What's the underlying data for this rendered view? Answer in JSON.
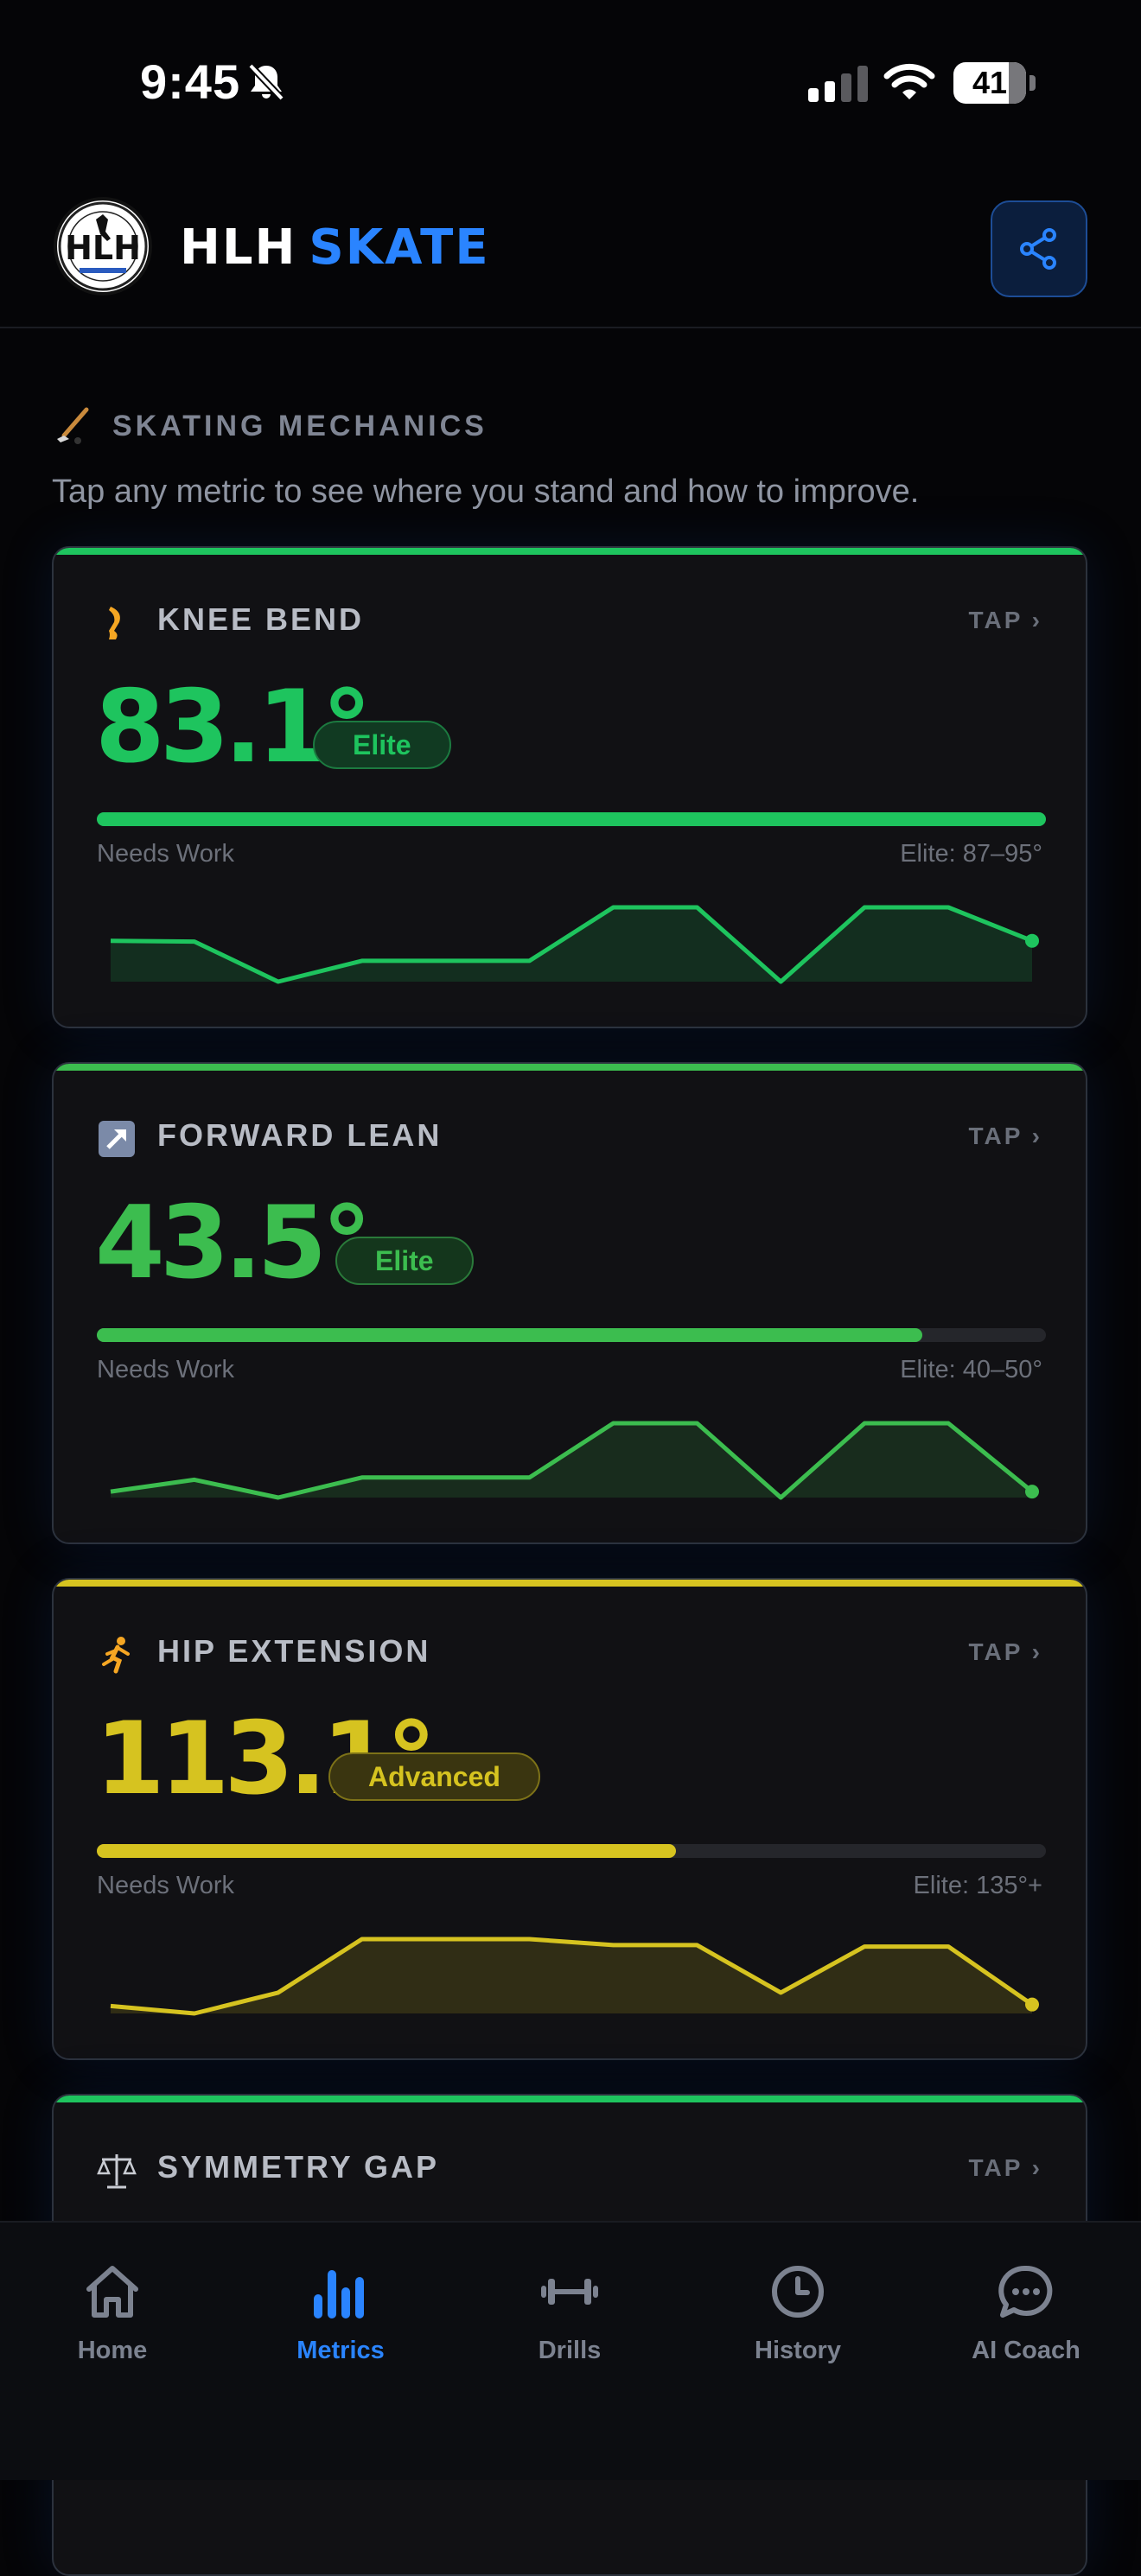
{
  "status_bar": {
    "time": "9:45",
    "battery": "41"
  },
  "header": {
    "brand_white": "HLH",
    "brand_blue": "SKATE",
    "share_icon": "share-icon",
    "logo_text": "HLH"
  },
  "section": {
    "icon": "hockey-stick-icon",
    "title": "SKATING MECHANICS",
    "subtitle": "Tap any metric to see where you stand and how to improve."
  },
  "cards": [
    {
      "icon": "leg-icon",
      "name": "KNEE BEND",
      "tap": "TAP ›",
      "value": "83.1°",
      "badge": "Elite",
      "progress": 1.0,
      "low_label": "Needs Work",
      "high_label": "Elite: 87–95°",
      "color": "#1ec45e",
      "trend": [
        0.55,
        0.54,
        0.0,
        0.28,
        0.28,
        0.28,
        1.0,
        1.0,
        0.0,
        1.0,
        1.0,
        0.55
      ]
    },
    {
      "icon": "arrow-up-right-icon",
      "name": "FORWARD LEAN",
      "tap": "TAP ›",
      "value": "43.5°",
      "badge": "Elite",
      "progress": 0.87,
      "low_label": "Needs Work",
      "high_label": "Elite: 40–50°",
      "color": "#3cbd4f",
      "trend": [
        0.08,
        0.24,
        0.0,
        0.27,
        0.27,
        0.27,
        1.0,
        1.0,
        0.0,
        1.0,
        1.0,
        0.08
      ]
    },
    {
      "icon": "running-person-icon",
      "name": "HIP EXTENSION",
      "tap": "TAP ›",
      "value": "113.1°",
      "badge": "Advanced",
      "progress": 0.61,
      "low_label": "Needs Work",
      "high_label": "Elite: 135°+",
      "color": "#d6c320",
      "trend": [
        0.1,
        0.0,
        0.28,
        1.0,
        1.0,
        1.0,
        0.92,
        0.92,
        0.28,
        0.9,
        0.9,
        0.12
      ]
    },
    {
      "icon": "scales-icon",
      "name": "SYMMETRY GAP",
      "tap": "TAP ›",
      "color": "#1ec45e"
    }
  ],
  "tabs": [
    {
      "label": "Home",
      "icon": "home-icon",
      "active": false
    },
    {
      "label": "Metrics",
      "icon": "bar-chart-icon",
      "active": true
    },
    {
      "label": "Drills",
      "icon": "dumbbell-icon",
      "active": false
    },
    {
      "label": "History",
      "icon": "clock-icon",
      "active": false
    },
    {
      "label": "AI Coach",
      "icon": "chat-bubble-icon",
      "active": false
    }
  ]
}
